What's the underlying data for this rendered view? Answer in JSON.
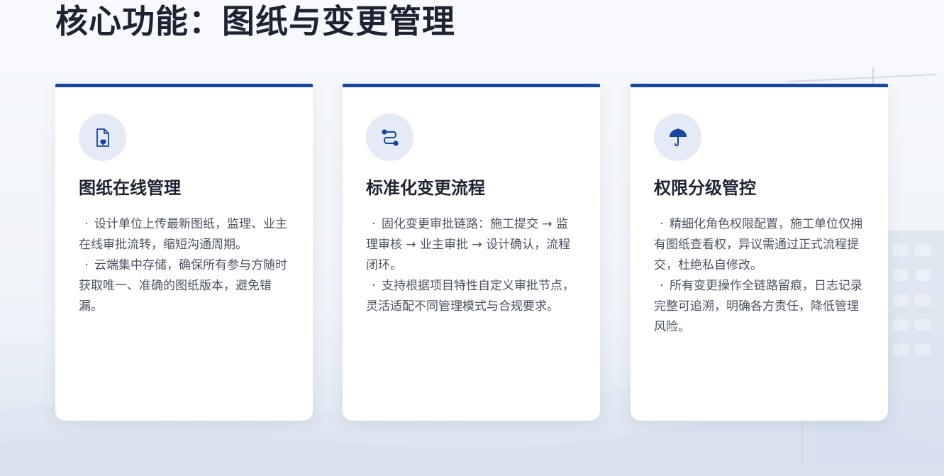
{
  "title": "核心功能：图纸与变更管理",
  "accent_color": "#17479e",
  "cards": [
    {
      "icon": "document-heart-icon",
      "title": "图纸在线管理",
      "items": [
        "设计单位上传最新图纸，监理、业主在线审批流转，缩短沟通周期。",
        "云端集中存储，确保所有参与方随时获取唯一、准确的图纸版本，避免错漏。"
      ]
    },
    {
      "icon": "workflow-icon",
      "title": "标准化变更流程",
      "items": [
        "固化变更审批链路：施工提交 → 监理审核 → 业主审批 → 设计确认，流程闭环。",
        "支持根据项目特性自定义审批节点，灵活适配不同管理模式与合规要求。"
      ]
    },
    {
      "icon": "umbrella-icon",
      "title": "权限分级管控",
      "items": [
        "精细化角色权限配置，施工单位仅拥有图纸查看权，异议需通过正式流程提交，杜绝私自修改。",
        "所有变更操作全链路留痕，日志记录完整可追溯，明确各方责任，降低管理风险。"
      ]
    }
  ]
}
